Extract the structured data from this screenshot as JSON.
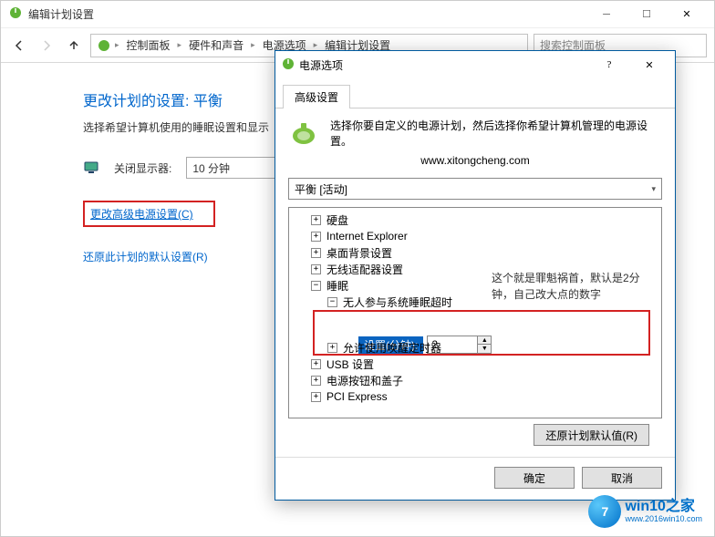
{
  "window": {
    "title": "编辑计划设置",
    "breadcrumbs": [
      "控制面板",
      "硬件和声音",
      "电源选项",
      "编辑计划设置"
    ],
    "search_placeholder": "搜索控制面板"
  },
  "content": {
    "heading": "更改计划的设置: 平衡",
    "desc": "选择希望计算机使用的睡眠设置和显示",
    "turn_off_label": "关闭显示器:",
    "turn_off_value": "10 分钟",
    "adv_link": "更改高级电源设置(C)",
    "restore_link": "还原此计划的默认设置(R)"
  },
  "dialog": {
    "title": "电源选项",
    "tab": "高级设置",
    "intro": "选择你要自定义的电源计划，然后选择你希望计算机管理的电源设置。",
    "url": "www.xitongcheng.com",
    "plan": "平衡 [活动]",
    "tree": {
      "hard_disk": "硬盘",
      "ie": "Internet Explorer",
      "desktop_bg": "桌面背景设置",
      "wireless": "无线适配器设置",
      "sleep": "睡眠",
      "unattended": "无人参与系统睡眠超时",
      "setting_label": "设置(分钟):",
      "setting_value": "2",
      "wake_timers": "允许使用唤醒定时器",
      "usb": "USB 设置",
      "power_button": "电源按钮和盖子",
      "pci": "PCI Express"
    },
    "annotation": "这个就是罪魁祸首，默认是2分钟，自己改大点的数字",
    "restore_btn": "还原计划默认值(R)",
    "ok": "确定",
    "cancel": "取消"
  },
  "watermark": {
    "logo": "7",
    "big": "win10之家",
    "small": "www.2016win10.com"
  }
}
